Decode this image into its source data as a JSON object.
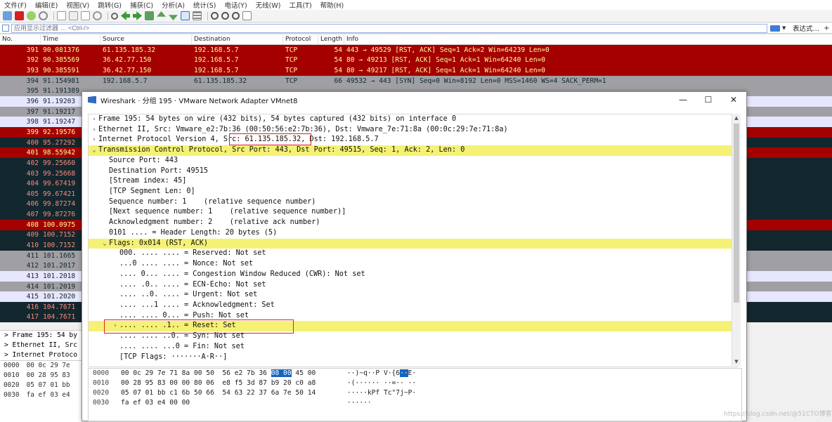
{
  "menu": [
    "文件(F)",
    "编辑(E)",
    "视图(V)",
    "跳转(G)",
    "捕获(C)",
    "分析(A)",
    "统计(S)",
    "电话(Y)",
    "无线(W)",
    "工具(T)",
    "帮助(H)"
  ],
  "filter": {
    "placeholder": "应用显示过滤器 … <Ctrl-/>",
    "expression_label": "表达式…",
    "plus": "+"
  },
  "columns": [
    "No.",
    "Time",
    "Source",
    "Destination",
    "Protocol",
    "Length",
    "Info"
  ],
  "packets": [
    {
      "no": "391",
      "time": "90.081376",
      "src": "61.135.185.32",
      "dst": "192.168.5.7",
      "proto": "TCP",
      "len": "54",
      "info": "443 → 49529 [RST, ACK] Seq=1 Ack=2 Win=64239 Len=0",
      "style": "red"
    },
    {
      "no": "392",
      "time": "90.385569",
      "src": "36.42.77.150",
      "dst": "192.168.5.7",
      "proto": "TCP",
      "len": "54",
      "info": "80 → 49213 [RST, ACK] Seq=1 Ack=1 Win=64240 Len=0",
      "style": "red"
    },
    {
      "no": "393",
      "time": "90.385591",
      "src": "36.42.77.150",
      "dst": "192.168.5.7",
      "proto": "TCP",
      "len": "54",
      "info": "80 → 49217 [RST, ACK] Seq=1 Ack=1 Win=64240 Len=0",
      "style": "red"
    },
    {
      "no": "394",
      "time": "91.154981",
      "src": "192.168.5.7",
      "dst": "61.135.185.32",
      "proto": "TCP",
      "len": "66",
      "info": "49532 → 443 [SYN] Seq=0 Win=8192 Len=0 MSS=1460 WS=4 SACK_PERM=1",
      "style": "gray"
    },
    {
      "no": "395",
      "time": "91.191389",
      "src": "",
      "dst": "",
      "proto": "",
      "len": "",
      "info": "",
      "style": "gray"
    },
    {
      "no": "396",
      "time": "91.19203",
      "src": "",
      "dst": "",
      "proto": "",
      "len": "",
      "info": "",
      "style": "lav"
    },
    {
      "no": "397",
      "time": "91.19217",
      "src": "",
      "dst": "",
      "proto": "",
      "len": "",
      "info": "",
      "style": "gray"
    },
    {
      "no": "398",
      "time": "91.19247",
      "src": "",
      "dst": "",
      "proto": "",
      "len": "",
      "info": "",
      "style": "lav"
    },
    {
      "no": "399",
      "time": "92.19576",
      "src": "",
      "dst": "",
      "proto": "",
      "len": "",
      "info": "",
      "style": "red"
    },
    {
      "no": "400",
      "time": "95.27292",
      "src": "",
      "dst": "",
      "proto": "",
      "len": "",
      "info": "",
      "style": "dark"
    },
    {
      "no": "401",
      "time": "98.55942",
      "src": "",
      "dst": "",
      "proto": "",
      "len": "",
      "info": "",
      "style": "red"
    },
    {
      "no": "402",
      "time": "99.25660",
      "src": "",
      "dst": "",
      "proto": "",
      "len": "",
      "info": "",
      "style": "dark"
    },
    {
      "no": "403",
      "time": "99.25668",
      "src": "",
      "dst": "",
      "proto": "",
      "len": "",
      "info": "",
      "style": "dark"
    },
    {
      "no": "404",
      "time": "99.67419",
      "src": "",
      "dst": "",
      "proto": "",
      "len": "",
      "info": "",
      "style": "dark"
    },
    {
      "no": "405",
      "time": "99.67421",
      "src": "",
      "dst": "",
      "proto": "",
      "len": "",
      "info": "",
      "style": "dark"
    },
    {
      "no": "406",
      "time": "99.87274",
      "src": "",
      "dst": "",
      "proto": "",
      "len": "",
      "info": "",
      "style": "dark"
    },
    {
      "no": "407",
      "time": "99.87276",
      "src": "",
      "dst": "",
      "proto": "",
      "len": "",
      "info": "",
      "style": "dark"
    },
    {
      "no": "408",
      "time": "100.0975",
      "src": "",
      "dst": "",
      "proto": "",
      "len": "",
      "info": "",
      "style": "red"
    },
    {
      "no": "409",
      "time": "100.7152",
      "src": "",
      "dst": "",
      "proto": "",
      "len": "",
      "info": "",
      "style": "dark"
    },
    {
      "no": "410",
      "time": "100.7152",
      "src": "",
      "dst": "",
      "proto": "",
      "len": "",
      "info": "",
      "style": "dark"
    },
    {
      "no": "411",
      "time": "101.1665",
      "src": "",
      "dst": "",
      "proto": "",
      "len": "",
      "info": "",
      "style": "gray"
    },
    {
      "no": "412",
      "time": "101.2017",
      "src": "",
      "dst": "",
      "proto": "",
      "len": "",
      "info": "",
      "style": "gray"
    },
    {
      "no": "413",
      "time": "101.2018",
      "src": "",
      "dst": "",
      "proto": "",
      "len": "",
      "info": "",
      "style": "lav"
    },
    {
      "no": "414",
      "time": "101.2019",
      "src": "",
      "dst": "",
      "proto": "",
      "len": "",
      "info": "",
      "style": "gray"
    },
    {
      "no": "415",
      "time": "101.2020",
      "src": "",
      "dst": "",
      "proto": "",
      "len": "",
      "info": "",
      "style": "lav"
    },
    {
      "no": "416",
      "time": "104.7671",
      "src": "",
      "dst": "",
      "proto": "",
      "len": "",
      "info": "",
      "style": "dark"
    },
    {
      "no": "417",
      "time": "104.7671",
      "src": "",
      "dst": "",
      "proto": "",
      "len": "",
      "info": "",
      "style": "dark"
    }
  ],
  "detail_left": [
    "> Frame 195: 54 by",
    "> Ethernet II, Src",
    "> Internet Protoco"
  ],
  "bytes_left": [
    {
      "off": "0000",
      "hex": "00 0c 29 7e"
    },
    {
      "off": "0010",
      "hex": "00 28 95 83"
    },
    {
      "off": "0020",
      "hex": "05 07 01 bb"
    },
    {
      "off": "0030",
      "hex": "fa ef 03 e4"
    }
  ],
  "dialog": {
    "title": "Wireshark · 分组 195 · VMware Network Adapter VMnet8",
    "controls": [
      "—",
      "☐",
      "✕"
    ],
    "tree": [
      {
        "indent": 0,
        "arrow": ">",
        "text": "Frame 195: 54 bytes on wire (432 bits), 54 bytes captured (432 bits) on interface 0",
        "hl": false
      },
      {
        "indent": 0,
        "arrow": ">",
        "text": "Ethernet II, Src: Vmware_e2:7b:36 (00:50:56:e2:7b:36), Dst: Vmware_7e:71:8a (00:0c:29:7e:71:8a)",
        "hl": false
      },
      {
        "indent": 0,
        "arrow": ">",
        "text": "Internet Protocol Version 4, Src: 61.135.185.32, Dst: 192.168.5.7",
        "hl": false
      },
      {
        "indent": 0,
        "arrow": "v",
        "text": "Transmission Control Protocol, Src Port: 443, Dst Port: 49515, Seq: 1, Ack: 2, Len: 0",
        "hl": true
      },
      {
        "indent": 1,
        "arrow": "",
        "text": "Source Port: 443",
        "hl": false
      },
      {
        "indent": 1,
        "arrow": "",
        "text": "Destination Port: 49515",
        "hl": false
      },
      {
        "indent": 1,
        "arrow": "",
        "text": "[Stream index: 45]",
        "hl": false
      },
      {
        "indent": 1,
        "arrow": "",
        "text": "[TCP Segment Len: 0]",
        "hl": false
      },
      {
        "indent": 1,
        "arrow": "",
        "text": "Sequence number: 1    (relative sequence number)",
        "hl": false
      },
      {
        "indent": 1,
        "arrow": "",
        "text": "[Next sequence number: 1    (relative sequence number)]",
        "hl": false
      },
      {
        "indent": 1,
        "arrow": "",
        "text": "Acknowledgment number: 2    (relative ack number)",
        "hl": false
      },
      {
        "indent": 1,
        "arrow": "",
        "text": "0101 .... = Header Length: 20 bytes (5)",
        "hl": false
      },
      {
        "indent": 1,
        "arrow": "v",
        "text": "Flags: 0x014 (RST, ACK)",
        "hl": true
      },
      {
        "indent": 2,
        "arrow": "",
        "text": "000. .... .... = Reserved: Not set",
        "hl": false
      },
      {
        "indent": 2,
        "arrow": "",
        "text": "...0 .... .... = Nonce: Not set",
        "hl": false
      },
      {
        "indent": 2,
        "arrow": "",
        "text": ".... 0... .... = Congestion Window Reduced (CWR): Not set",
        "hl": false
      },
      {
        "indent": 2,
        "arrow": "",
        "text": ".... .0.. .... = ECN-Echo: Not set",
        "hl": false
      },
      {
        "indent": 2,
        "arrow": "",
        "text": ".... ..0. .... = Urgent: Not set",
        "hl": false
      },
      {
        "indent": 2,
        "arrow": "",
        "text": ".... ...1 .... = Acknowledgment: Set",
        "hl": false
      },
      {
        "indent": 2,
        "arrow": "",
        "text": ".... .... 0... = Push: Not set",
        "hl": false
      },
      {
        "indent": 2,
        "arrow": ">",
        "text": ".... .... .1.. = Reset: Set",
        "hl": true
      },
      {
        "indent": 2,
        "arrow": "",
        "text": ".... .... ..0. = Syn: Not set",
        "hl": false
      },
      {
        "indent": 2,
        "arrow": "",
        "text": ".... .... ...0 = Fin: Not set",
        "hl": false
      },
      {
        "indent": 2,
        "arrow": "",
        "text": "[TCP Flags: ·······A·R··]",
        "hl": false
      }
    ],
    "hex": [
      {
        "off": "0000",
        "pre": "00 0c 29 7e 71 8a 00 50  56 e2 7b 36 ",
        "sel": "08 00",
        "post": " 45 00",
        "apre": "··)~q··P V·{6",
        "asel": "··",
        "apost": "E·"
      },
      {
        "off": "0010",
        "pre": "00 28 95 83 00 00 80 06  e8 f5 3d 87 b9 20 c0 a8",
        "sel": "",
        "post": "",
        "apre": "·(······ ··=·· ··",
        "asel": "",
        "apost": ""
      },
      {
        "off": "0020",
        "pre": "05 07 01 bb c1 6b 50 66  54 63 22 37 6a 7e 50 14",
        "sel": "",
        "post": "",
        "apre": "·····kPf Tc\"7j~P·",
        "asel": "",
        "apost": ""
      },
      {
        "off": "0030",
        "pre": "fa ef 03 e4 00 00",
        "sel": "",
        "post": "",
        "apre": "······",
        "asel": "",
        "apost": ""
      }
    ]
  },
  "watermark": "https://blog.csdn.net/@51CTO博客",
  "colors": {
    "red_row": "#a40000",
    "gray_row": "#a0a0a4",
    "dark_row": "#12272e",
    "highlight": "#f5f174",
    "annotation": "#e02020"
  }
}
